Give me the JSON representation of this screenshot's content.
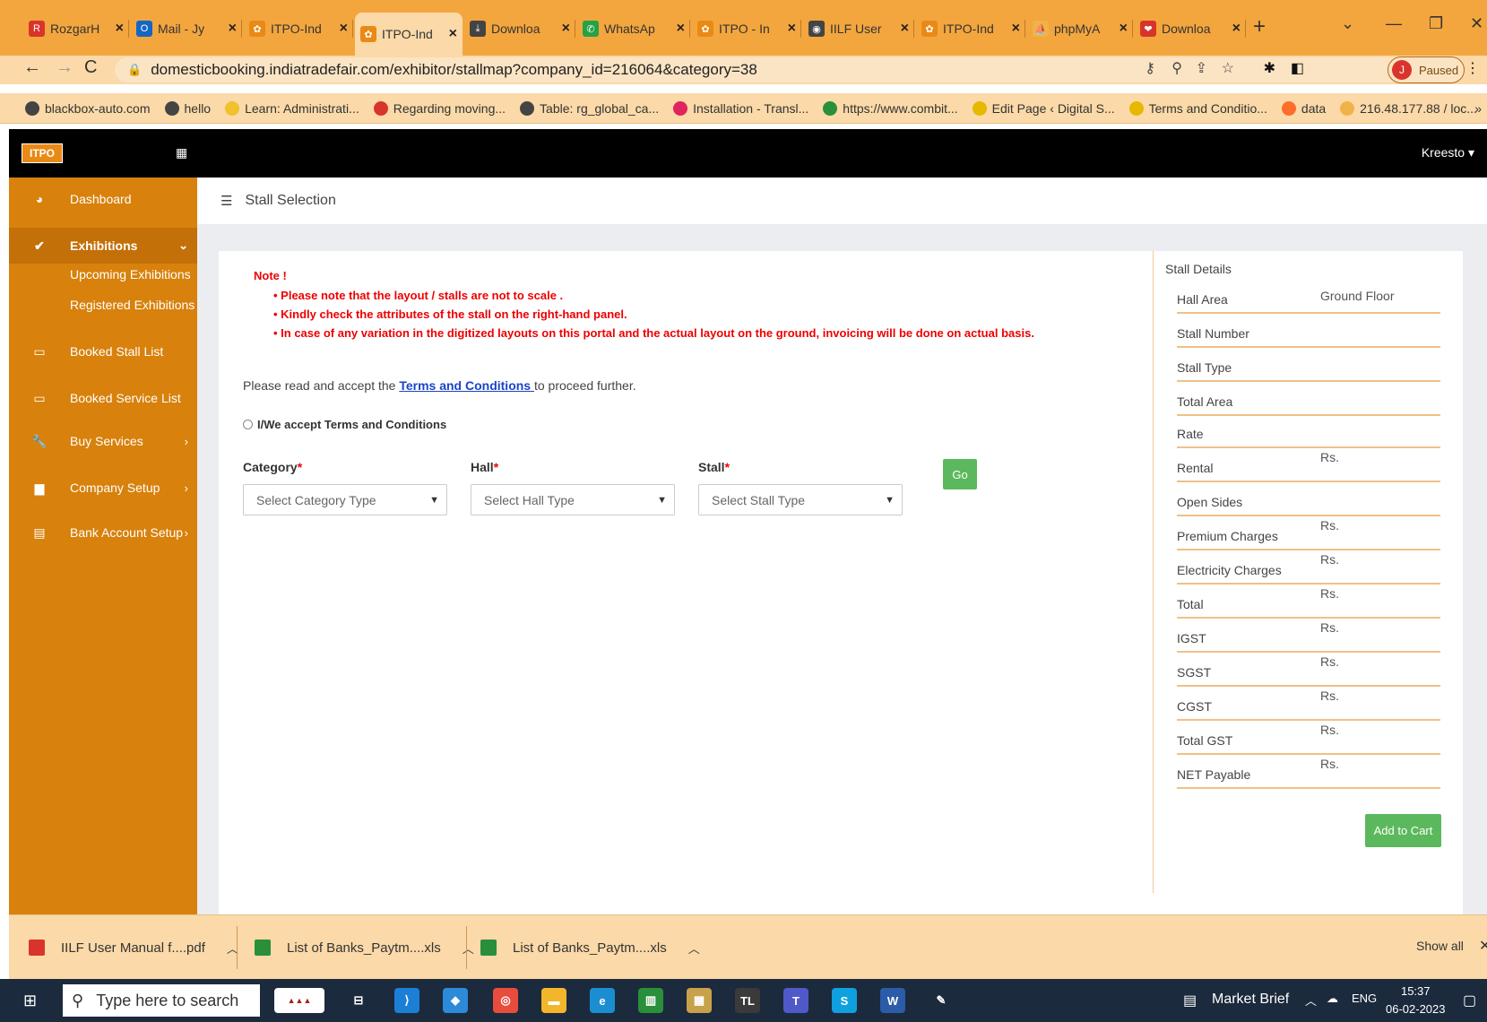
{
  "browser": {
    "tabs": [
      {
        "label": "RozgarH",
        "icon": "rozgar-icon",
        "color": "#d9342b",
        "glyph": "R"
      },
      {
        "label": "Mail - Jy",
        "icon": "outlook-icon",
        "color": "#1466c4",
        "glyph": "O"
      },
      {
        "label": "ITPO-Ind",
        "icon": "itpo-icon",
        "color": "#e98a16",
        "glyph": "✿"
      },
      {
        "label": "ITPO-Ind",
        "icon": "itpo-icon",
        "color": "#e98a16",
        "glyph": "✿"
      },
      {
        "label": "Downloa",
        "icon": "download-icon",
        "color": "#444444",
        "glyph": "⤓"
      },
      {
        "label": "WhatsAp",
        "icon": "whatsapp-icon",
        "color": "#25a244",
        "glyph": "✆"
      },
      {
        "label": "ITPO - In",
        "icon": "itpo-icon",
        "color": "#e98a16",
        "glyph": "✿"
      },
      {
        "label": "IILF User",
        "icon": "globe-icon",
        "color": "#444444",
        "glyph": "◉"
      },
      {
        "label": "ITPO-Ind",
        "icon": "itpo-icon",
        "color": "#e98a16",
        "glyph": "✿"
      },
      {
        "label": "phpMyA",
        "icon": "phpmyadmin-icon",
        "color": "#f0b24a",
        "glyph": "⛵"
      },
      {
        "label": "Downloa",
        "icon": "heart-icon",
        "color": "#d9342b",
        "glyph": "❤"
      }
    ],
    "url": "domesticbooking.indiatradefair.com/exhibitor/stallmap?company_id=216064&category=38",
    "profile_initial": "J",
    "profile_status": "Paused",
    "bookmarks": [
      {
        "label": "blackbox-auto.com",
        "icon": "globe-icon",
        "color": "#444444"
      },
      {
        "label": "hello",
        "icon": "globe-icon",
        "color": "#444444"
      },
      {
        "label": "Learn: Administrati...",
        "icon": "learn-icon",
        "color": "#f2c12e"
      },
      {
        "label": "Regarding moving...",
        "icon": "gmail-icon",
        "color": "#d9342b"
      },
      {
        "label": "Table: rg_global_ca...",
        "icon": "globe-icon",
        "color": "#444444"
      },
      {
        "label": "Installation - Transl...",
        "icon": "bookmark-square-icon",
        "color": "#e0245e"
      },
      {
        "label": "https://www.combit...",
        "icon": "combit-icon",
        "color": "#2a8f3a"
      },
      {
        "label": "Edit Page ‹ Digital S...",
        "icon": "feather-icon",
        "color": "#e6b800"
      },
      {
        "label": "Terms and Conditio...",
        "icon": "feather-icon",
        "color": "#e6b800"
      },
      {
        "label": "data",
        "icon": "cpanel-icon",
        "color": "#ff6c2c"
      },
      {
        "label": "216.48.177.88 / loc...",
        "icon": "phpmyadmin-icon",
        "color": "#f0b24a"
      }
    ]
  },
  "app": {
    "user": "Kreesto ▾",
    "page_title": "Stall Selection",
    "sidebar": {
      "items": [
        {
          "label": "Dashboard",
          "icon": "dashboard-icon",
          "glyph": "◕"
        },
        {
          "label": "Exhibitions",
          "icon": "exhibitions-icon",
          "glyph": "✔"
        },
        {
          "label": "Booked Stall List",
          "icon": "inbox-icon",
          "glyph": "▭"
        },
        {
          "label": "Booked Service List",
          "icon": "inbox-icon",
          "glyph": "▭"
        },
        {
          "label": "Buy Services",
          "icon": "wrench-icon",
          "glyph": "🔧"
        },
        {
          "label": "Company Setup",
          "icon": "briefcase-icon",
          "glyph": "▆"
        },
        {
          "label": "Bank Account Setup",
          "icon": "credit-card-icon",
          "glyph": "▤"
        }
      ],
      "subitems": [
        "Upcoming Exhibitions",
        "Registered Exhibitions"
      ]
    },
    "note": {
      "title": "Note !",
      "lines": [
        "•  Please note that the layout / stalls are not to scale .",
        "•  Kindly check the attributes of the stall on the right-hand panel.",
        "•  In case of any variation in the digitized layouts on this portal and the actual layout on the ground, invoicing will be done on actual basis."
      ]
    },
    "terms": {
      "prefix": "Please read and accept the ",
      "link": "Terms and Conditions ",
      "suffix": "to proceed further.",
      "accept_label": "I/We accept Terms and Conditions"
    },
    "form": {
      "category_label": "Category",
      "category_placeholder": "Select Category Type",
      "hall_label": "Hall",
      "hall_placeholder": "Select Hall Type",
      "stall_label": "Stall",
      "stall_placeholder": "Select Stall Type",
      "required_mark": "*",
      "go_label": "Go"
    },
    "stall_details": {
      "title": "Stall Details",
      "rows": [
        {
          "label": "Hall Area",
          "value": "Ground Floor"
        },
        {
          "label": "Stall Number",
          "value": ""
        },
        {
          "label": "Stall Type",
          "value": ""
        },
        {
          "label": "Total Area",
          "value": ""
        },
        {
          "label": "Rate",
          "value": ""
        },
        {
          "label": "Rental",
          "value": "Rs."
        },
        {
          "label": "Open Sides",
          "value": ""
        },
        {
          "label": "Premium Charges",
          "value": "Rs."
        },
        {
          "label": "Electricity Charges",
          "value": "Rs."
        },
        {
          "label": "Total",
          "value": "Rs."
        },
        {
          "label": "IGST",
          "value": "Rs."
        },
        {
          "label": "SGST",
          "value": "Rs."
        },
        {
          "label": "CGST",
          "value": "Rs."
        },
        {
          "label": "Total GST",
          "value": "Rs."
        },
        {
          "label": "NET Payable",
          "value": "Rs."
        }
      ],
      "add_to_cart": "Add to Cart"
    }
  },
  "downloads": {
    "items": [
      {
        "label": "IILF User Manual f....pdf",
        "icon": "pdf-icon",
        "color": "#d9342b"
      },
      {
        "label": "List of Banks_Paytm....xls",
        "icon": "excel-icon",
        "color": "#2a8f3a"
      },
      {
        "label": "List of Banks_Paytm....xls",
        "icon": "excel-icon",
        "color": "#2a8f3a"
      }
    ],
    "show_all": "Show all"
  },
  "taskbar": {
    "search_placeholder": "Type here to search",
    "news": "Market Brief",
    "lang": "ENG",
    "time": "15:37",
    "date": "06-02-2023"
  }
}
